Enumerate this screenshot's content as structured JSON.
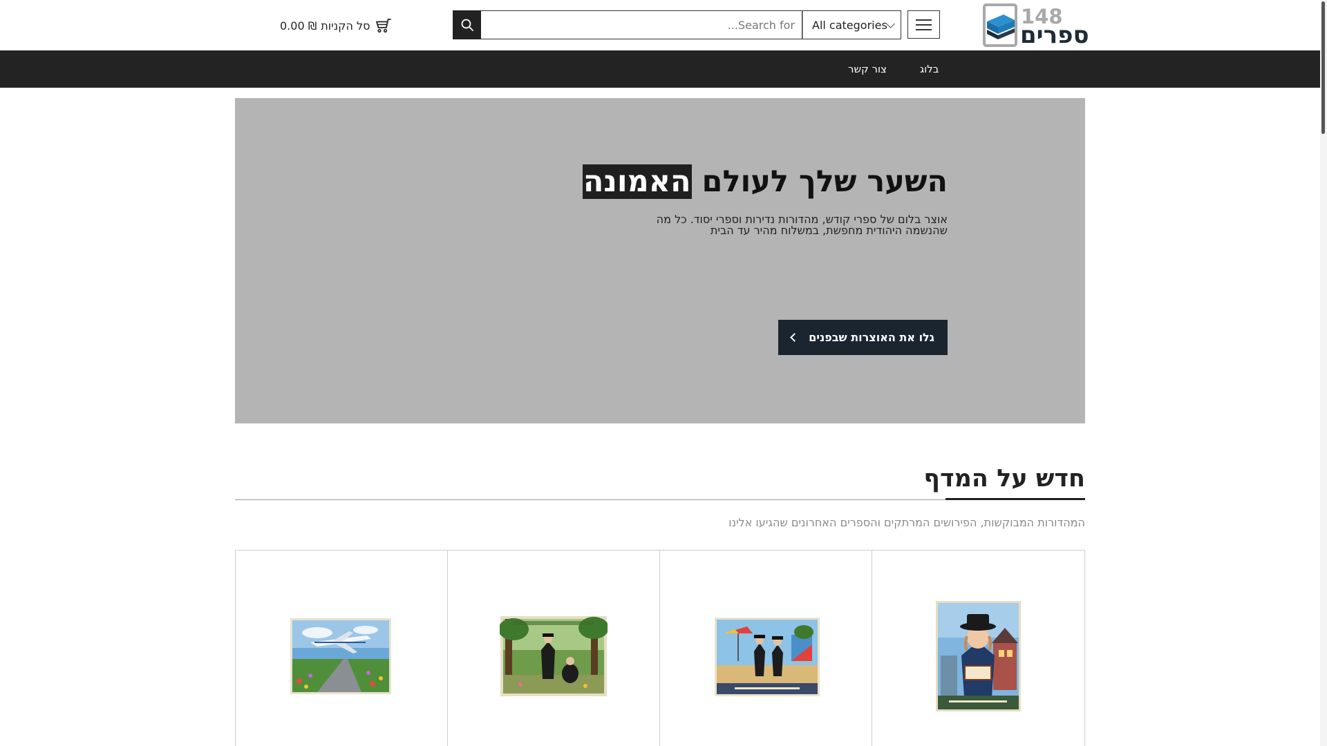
{
  "header": {
    "logo": {
      "number": "148",
      "word": "ספרים"
    },
    "search": {
      "placeholder": "...Search for",
      "value": ""
    },
    "category_select": {
      "selected": "All categories"
    },
    "cart": {
      "label": "סל הקניות",
      "total": "0.00 ₪"
    }
  },
  "nav": {
    "items": [
      {
        "label": "בלוג"
      },
      {
        "label": "צור קשר"
      }
    ]
  },
  "hero": {
    "title_plain": "השער שלך לעולם",
    "title_highlight": "האמונה",
    "subtitle": "אוצר בלום של ספרי קודש, מהדורות נדירות וספרי יסוד. כל מה שהנשמה היהודית מחפשת, במשלוח מהיר עד הבית",
    "cta_label": "גלו את האוצרות שבפנים"
  },
  "section": {
    "title": "חדש על המדף",
    "subtitle": "המהדורות המבוקשות, הפירושים המרתקים והספרים האחרונים שהגיעו אלינו"
  },
  "products": [
    {
      "icon": "book-cover-airplane-image"
    },
    {
      "icon": "book-cover-forest-image"
    },
    {
      "icon": "book-cover-playground-image"
    },
    {
      "icon": "book-cover-boy-reading-image"
    }
  ],
  "colors": {
    "navbar": "#232323",
    "hero_bg": "#b4b4b4",
    "cta_bg": "#1b2530",
    "logo_blue": "#1f7bb8"
  }
}
